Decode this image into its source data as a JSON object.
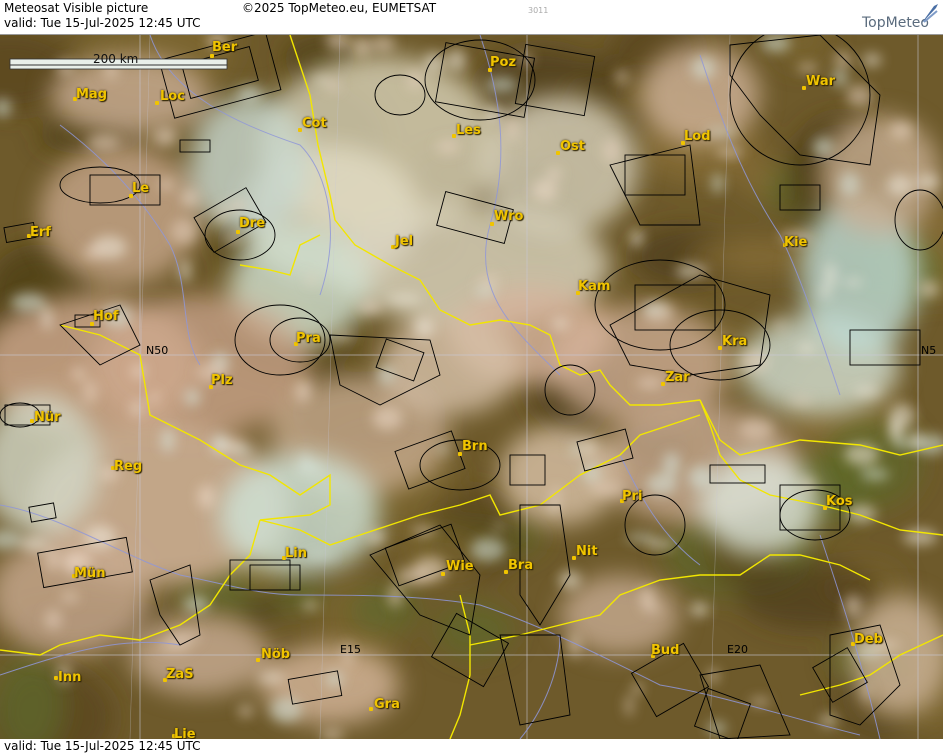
{
  "header": {
    "title": "Meteosat Visible picture",
    "valid": "valid:  Tue  15-Jul-2025  12:45 UTC",
    "copyright": "©2025 TopMeteo.eu, EUMETSAT",
    "code": "3011",
    "logo": "TopMeteo"
  },
  "footer": {
    "valid": "valid:  Tue  15-Jul-2025  12:45 UTC"
  },
  "map": {
    "scale_label": "200 km",
    "grid_labels": {
      "n50": "N50",
      "n50_right": "N5",
      "e15": "E15",
      "e20": "E20"
    },
    "cities": [
      "Ber",
      "Mag",
      "Loc",
      "Cot",
      "Poz",
      "Les",
      "Ost",
      "War",
      "Lod",
      "Le",
      "Dre",
      "Wro",
      "Erf",
      "Jel",
      "Kie",
      "Kam",
      "Hof",
      "Pra",
      "Kra",
      "Plz",
      "Zar",
      "Nür",
      "Brn",
      "Reg",
      "Pri",
      "Kos",
      "Lin",
      "Wie",
      "Bra",
      "Nit",
      "Mün",
      "Inn",
      "ZaS",
      "Nöb",
      "Bud",
      "Deb",
      "Gra",
      "Lie"
    ]
  },
  "colors": {
    "border": "#f2e600",
    "river": "#8f97d8",
    "label": "#f0c400",
    "grid": "#c8c8d8"
  }
}
